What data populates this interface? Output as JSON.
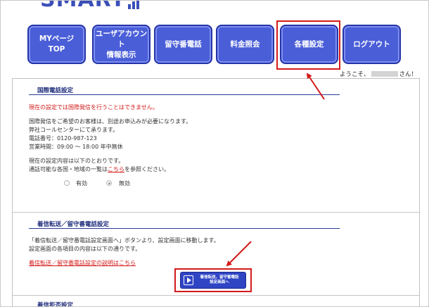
{
  "logo": {
    "text": "SMART"
  },
  "nav": [
    {
      "label": "MYページ\nTOP"
    },
    {
      "label": "ユーザアカウント\n情報表示"
    },
    {
      "label": "留守番電話"
    },
    {
      "label": "料金照会"
    },
    {
      "label": "各種設定"
    },
    {
      "label": "ログアウト"
    }
  ],
  "welcome": {
    "prefix": "ようこそ、",
    "suffix": "さん！"
  },
  "intl": {
    "title": "国際電話設定",
    "notice": "現在の設定では国際発信を行うことはできません。",
    "info1": "国際発信をご希望のお客様は、別途お申込みが必要になります。",
    "info2": "弊社コールセンターにて承ります。",
    "info3": "電話番号：0120-987-123",
    "info4": "営業時間：09:00 ～ 18:00 年中無休",
    "current": "現在の設定内容は以下のとおりです。",
    "countries_pre": "通話可能な各国・地域の一覧は",
    "countries_link": "こちら",
    "countries_post": "を参照ください。",
    "option_on": "有効",
    "option_off": "無効"
  },
  "forward": {
    "title": "着信転送／留守番電話設定",
    "desc1": "「着信転送／留守番電話設定画面へ」ボタンより、設定画面に移動します。",
    "desc2": "設定画面の各項目の内容は以下の通りです。",
    "help_link": "着信転送／留守番電話設定の説明はこちら",
    "button_label": "着信転送、留守番電話\n設定画面へ"
  },
  "reject": {
    "title": "着信拒否設定"
  },
  "colors": {
    "accent": "#4a5ed8",
    "highlight": "#d41a1a",
    "title": "#1b2a7a"
  }
}
